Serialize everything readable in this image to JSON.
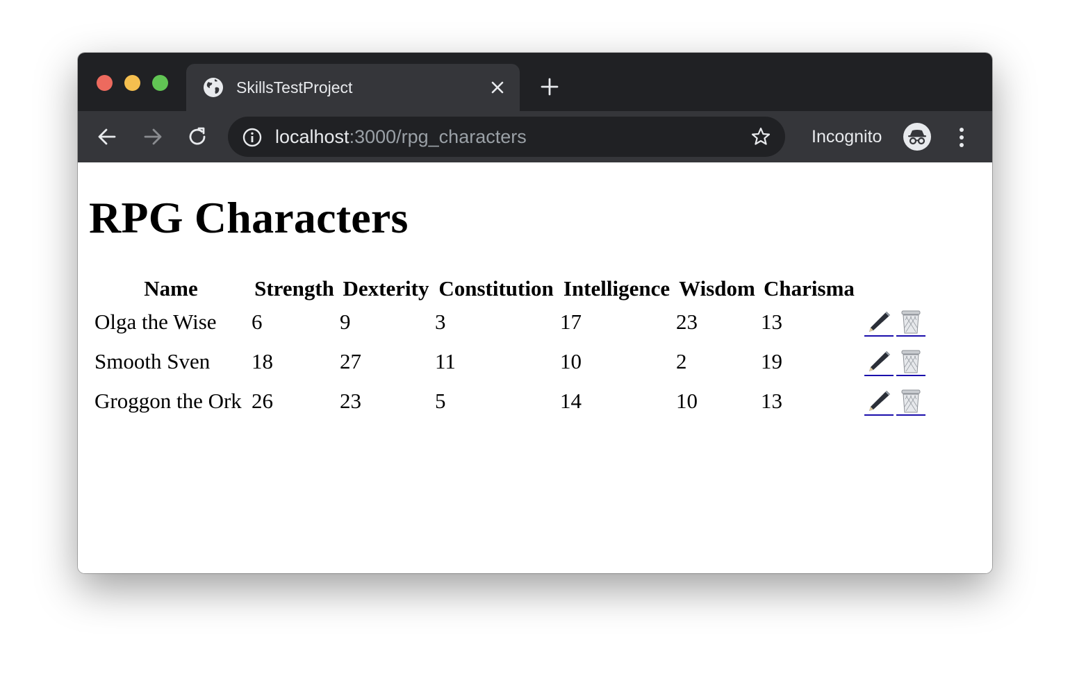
{
  "browser": {
    "tab_title": "SkillsTestProject",
    "url_host": "localhost",
    "url_path": ":3000/rpg_characters",
    "profile_label": "Incognito"
  },
  "page": {
    "title": "RPG Characters",
    "columns": [
      "Name",
      "Strength",
      "Dexterity",
      "Constitution",
      "Intelligence",
      "Wisdom",
      "Charisma"
    ],
    "rows": [
      {
        "name": "Olga the Wise",
        "strength": "6",
        "dexterity": "9",
        "constitution": "3",
        "intelligence": "17",
        "wisdom": "23",
        "charisma": "13"
      },
      {
        "name": "Smooth Sven",
        "strength": "18",
        "dexterity": "27",
        "constitution": "11",
        "intelligence": "10",
        "wisdom": "2",
        "charisma": "19"
      },
      {
        "name": "Groggon the Ork",
        "strength": "26",
        "dexterity": "23",
        "constitution": "5",
        "intelligence": "14",
        "wisdom": "10",
        "charisma": "13"
      }
    ],
    "row_actions": [
      "pencil-icon",
      "trash-icon"
    ]
  },
  "colors": {
    "titlebar": "#202124",
    "toolbar": "#35363a",
    "link_underline": "#1a0dab"
  }
}
